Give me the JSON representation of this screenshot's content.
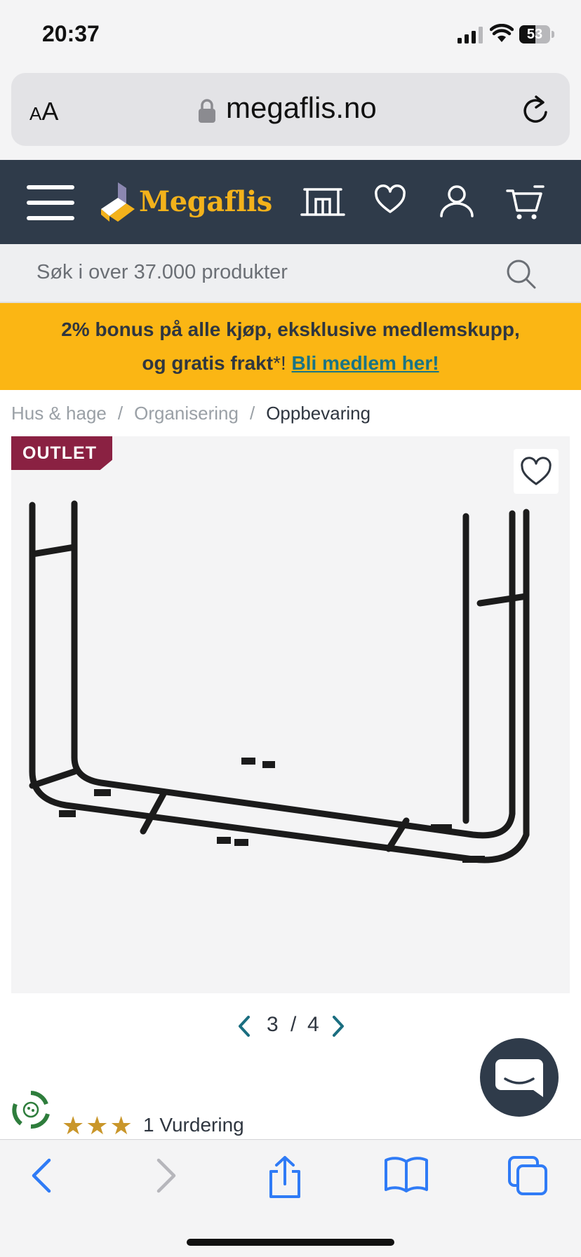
{
  "status_bar": {
    "time": "20:37",
    "battery": "53",
    "battery_level": 0.53
  },
  "browser": {
    "text_size_label": "AA",
    "url": "megaflis.no"
  },
  "header": {
    "logo": "Megaflis"
  },
  "search": {
    "placeholder": "Søk i over 37.000 produkter"
  },
  "promo": {
    "line1": "2% bonus på alle kjøp, eksklusive medlemskupp,",
    "line2_prefix": "og gratis frakt",
    "asterisk": "*",
    "exclaim": "!",
    "link": "Bli medlem her!"
  },
  "breadcrumbs": [
    "Hus & hage",
    "Organisering",
    "Oppbevaring"
  ],
  "product": {
    "badge": "OUTLET"
  },
  "pagination": {
    "current": "3",
    "separator": "/",
    "total": "4"
  },
  "rating": {
    "stars": 3,
    "stars_text": "★★★",
    "label": "1 Vurdering"
  },
  "colors": {
    "header": "#2f3b4a",
    "accent_yellow": "#fbb614",
    "outlet": "#8a2142",
    "link": "#1a7485",
    "ios_blue": "#2f7bf6"
  }
}
